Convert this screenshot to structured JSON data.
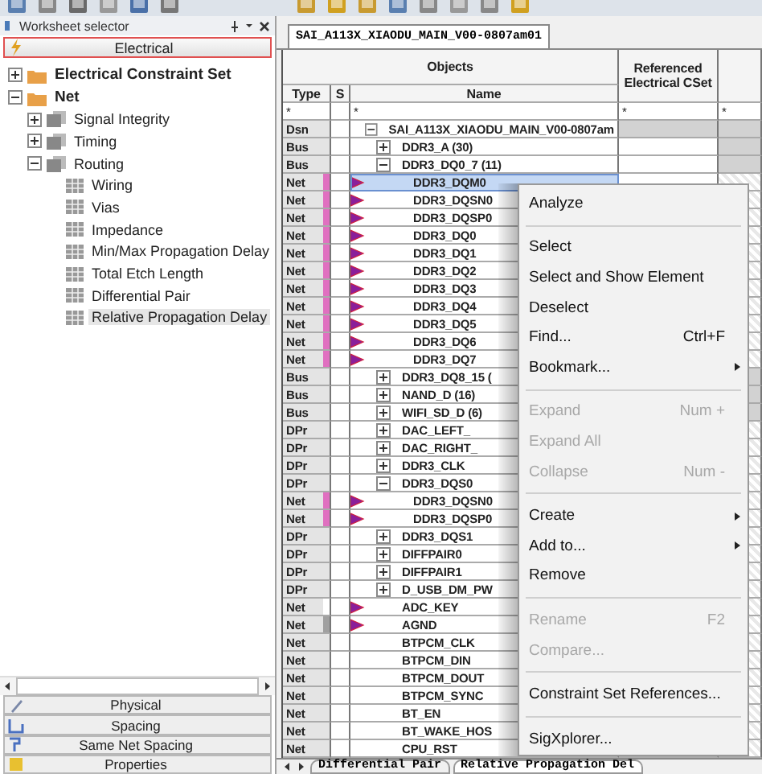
{
  "worksheet_selector": {
    "title": "Worksheet selector",
    "active_category": "Electrical",
    "tree": [
      {
        "label": "Electrical Constraint Set",
        "expanded": false,
        "selected": false
      },
      {
        "label": "Net",
        "expanded": true,
        "selected": false,
        "children": [
          {
            "label": "Signal Integrity",
            "expanded": false,
            "selected": false
          },
          {
            "label": "Timing",
            "expanded": false,
            "selected": false
          },
          {
            "label": "Routing",
            "expanded": true,
            "selected": false,
            "children": [
              {
                "label": "Wiring",
                "selected": false
              },
              {
                "label": "Vias",
                "selected": false
              },
              {
                "label": "Impedance",
                "selected": false
              },
              {
                "label": "Min/Max Propagation Delay",
                "selected": false
              },
              {
                "label": "Total Etch Length",
                "selected": false
              },
              {
                "label": "Differential Pair",
                "selected": false
              },
              {
                "label": "Relative Propagation Delay",
                "selected": true
              }
            ]
          }
        ]
      }
    ],
    "categories": [
      "Physical",
      "Spacing",
      "Same Net Spacing",
      "Properties"
    ]
  },
  "sheet": {
    "tab": "SAI_A113X_XIAODU_MAIN_V00-0807am01",
    "group_header": "Objects",
    "columns": {
      "type": "Type",
      "s": "S",
      "name": "Name",
      "cset": "Referenced Electrical CSet"
    },
    "filters": {
      "type": "*",
      "name": "*",
      "cset": "*",
      "column_5": "*"
    },
    "rows": [
      {
        "type": "Dsn",
        "name": "SAI_A113X_XIAODU_MAIN_V00-0807am",
        "expanded": true,
        "selected": false,
        "flagged": false,
        "children": [
          {
            "type": "Bus",
            "name": "DDR3_A (30)",
            "expanded": false,
            "selected": false,
            "flagged": false
          },
          {
            "type": "Bus",
            "name": "DDR3_DQ0_7 (11)",
            "expanded": true,
            "selected": false,
            "flagged": false,
            "children": [
              {
                "type": "Net",
                "name": "DDR3_DQM0",
                "selected": true,
                "flagged": true,
                "color": "#e070c0"
              },
              {
                "type": "Net",
                "name": "DDR3_DQSN0",
                "selected": false,
                "flagged": true,
                "color": "#e070c0"
              },
              {
                "type": "Net",
                "name": "DDR3_DQSP0",
                "selected": false,
                "flagged": true,
                "color": "#e070c0"
              },
              {
                "type": "Net",
                "name": "DDR3_DQ0",
                "selected": false,
                "flagged": true,
                "color": "#e070c0"
              },
              {
                "type": "Net",
                "name": "DDR3_DQ1",
                "selected": false,
                "flagged": true,
                "color": "#e070c0"
              },
              {
                "type": "Net",
                "name": "DDR3_DQ2",
                "selected": false,
                "flagged": true,
                "color": "#e070c0"
              },
              {
                "type": "Net",
                "name": "DDR3_DQ3",
                "selected": false,
                "flagged": true,
                "color": "#e070c0"
              },
              {
                "type": "Net",
                "name": "DDR3_DQ4",
                "selected": false,
                "flagged": true,
                "color": "#e070c0"
              },
              {
                "type": "Net",
                "name": "DDR3_DQ5",
                "selected": false,
                "flagged": true,
                "color": "#e070c0"
              },
              {
                "type": "Net",
                "name": "DDR3_DQ6",
                "selected": false,
                "flagged": true,
                "color": "#e070c0"
              },
              {
                "type": "Net",
                "name": "DDR3_DQ7",
                "selected": false,
                "flagged": true,
                "color": "#e070c0"
              }
            ]
          },
          {
            "type": "Bus",
            "name": "DDR3_DQ8_15 (",
            "expanded": false,
            "selected": false,
            "flagged": false
          },
          {
            "type": "Bus",
            "name": "NAND_D (16)",
            "expanded": false,
            "selected": false,
            "flagged": false
          },
          {
            "type": "Bus",
            "name": "WIFI_SD_D (6)",
            "expanded": false,
            "selected": false,
            "flagged": false
          },
          {
            "type": "DPr",
            "name": "DAC_LEFT_",
            "expanded": false,
            "selected": false,
            "flagged": false
          },
          {
            "type": "DPr",
            "name": "DAC_RIGHT_",
            "expanded": false,
            "selected": false,
            "flagged": false
          },
          {
            "type": "DPr",
            "name": "DDR3_CLK",
            "expanded": false,
            "selected": false,
            "flagged": false
          },
          {
            "type": "DPr",
            "name": "DDR3_DQS0",
            "expanded": true,
            "selected": false,
            "flagged": false,
            "children": [
              {
                "type": "Net",
                "name": "DDR3_DQSN0",
                "selected": false,
                "flagged": true,
                "color": "#e070c0"
              },
              {
                "type": "Net",
                "name": "DDR3_DQSP0",
                "selected": false,
                "flagged": true,
                "color": "#e070c0"
              }
            ]
          },
          {
            "type": "DPr",
            "name": "DDR3_DQS1",
            "expanded": false,
            "selected": false,
            "flagged": false
          },
          {
            "type": "DPr",
            "name": "DIFFPAIR0",
            "expanded": false,
            "selected": false,
            "flagged": false
          },
          {
            "type": "DPr",
            "name": "DIFFPAIR1",
            "expanded": false,
            "selected": false,
            "flagged": false
          },
          {
            "type": "DPr",
            "name": "D_USB_DM_PW",
            "expanded": false,
            "selected": false,
            "flagged": false
          },
          {
            "type": "Net",
            "name": "ADC_KEY",
            "selected": false,
            "flagged": true,
            "color": "#ffffff"
          },
          {
            "type": "Net",
            "name": "AGND",
            "selected": false,
            "flagged": true,
            "color": "#a0a0a0"
          },
          {
            "type": "Net",
            "name": "BTPCM_CLK",
            "selected": false,
            "flagged": false
          },
          {
            "type": "Net",
            "name": "BTPCM_DIN",
            "selected": false,
            "flagged": false
          },
          {
            "type": "Net",
            "name": "BTPCM_DOUT",
            "selected": false,
            "flagged": false
          },
          {
            "type": "Net",
            "name": "BTPCM_SYNC",
            "selected": false,
            "flagged": false
          },
          {
            "type": "Net",
            "name": "BT_EN",
            "selected": false,
            "flagged": false
          },
          {
            "type": "Net",
            "name": "BT_WAKE_HOS",
            "selected": false,
            "flagged": false
          },
          {
            "type": "Net",
            "name": "CPU_RST",
            "selected": false,
            "flagged": false
          }
        ]
      }
    ],
    "bottom_tabs": [
      {
        "label": "Differential Pair",
        "selected": false
      },
      {
        "label": "Relative Propagation Del",
        "selected": true
      }
    ]
  },
  "context_menu": {
    "items": [
      {
        "kind": "item",
        "label": "Analyze",
        "disabled": false,
        "submenu": false
      },
      {
        "kind": "separator"
      },
      {
        "kind": "item",
        "label": "Select",
        "disabled": false,
        "submenu": false
      },
      {
        "kind": "item",
        "label": "Select and Show Element",
        "disabled": false,
        "submenu": false
      },
      {
        "kind": "item",
        "label": "Deselect",
        "disabled": false,
        "submenu": false
      },
      {
        "kind": "item",
        "label": "Find...",
        "shortcut": "Ctrl+F",
        "disabled": false,
        "submenu": false
      },
      {
        "kind": "item",
        "label": "Bookmark...",
        "disabled": false,
        "submenu": true
      },
      {
        "kind": "separator"
      },
      {
        "kind": "item",
        "label": "Expand",
        "shortcut": "Num +",
        "disabled": true,
        "submenu": false
      },
      {
        "kind": "item",
        "label": "Expand All",
        "disabled": true,
        "submenu": false
      },
      {
        "kind": "item",
        "label": "Collapse",
        "shortcut": "Num -",
        "disabled": true,
        "submenu": false
      },
      {
        "kind": "separator"
      },
      {
        "kind": "item",
        "label": "Create",
        "disabled": false,
        "submenu": true
      },
      {
        "kind": "item",
        "label": "Add to...",
        "disabled": false,
        "submenu": true
      },
      {
        "kind": "item",
        "label": "Remove",
        "disabled": false,
        "submenu": false
      },
      {
        "kind": "separator"
      },
      {
        "kind": "item",
        "label": "Rename",
        "shortcut": "F2",
        "disabled": true,
        "submenu": false
      },
      {
        "kind": "item",
        "label": "Compare...",
        "disabled": true,
        "submenu": false
      },
      {
        "kind": "separator"
      },
      {
        "kind": "item",
        "label": "Constraint Set References...",
        "disabled": false,
        "submenu": false
      },
      {
        "kind": "separator"
      },
      {
        "kind": "item",
        "label": "SigXplorer...",
        "disabled": false,
        "submenu": false
      }
    ]
  }
}
